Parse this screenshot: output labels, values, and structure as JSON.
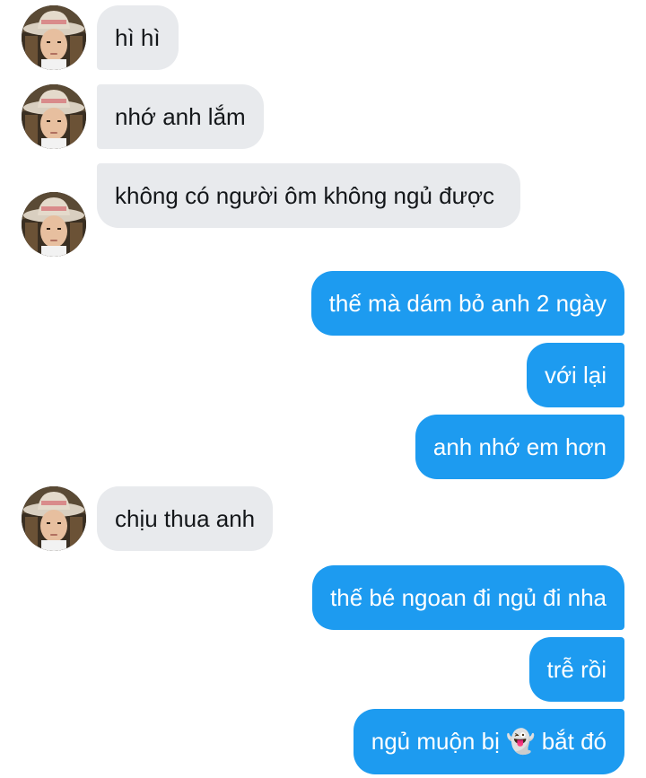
{
  "conversation": {
    "messages": [
      {
        "sender": "other",
        "text": "hì hì"
      },
      {
        "sender": "other",
        "text": "nhớ anh lắm"
      },
      {
        "sender": "other",
        "text": "không có người ôm không ngủ được"
      },
      {
        "sender": "self",
        "text": "thế mà dám bỏ anh 2 ngày"
      },
      {
        "sender": "self",
        "text": "với lại"
      },
      {
        "sender": "self",
        "text": "anh nhớ em hơn"
      },
      {
        "sender": "other",
        "text": "chịu thua anh"
      },
      {
        "sender": "self",
        "text": "thế bé ngoan đi ngủ đi nha"
      },
      {
        "sender": "self",
        "text": "trễ rồi"
      },
      {
        "sender": "self",
        "text_before": "ngủ muộn bị",
        "emoji": "👻",
        "text_after": "bắt đó"
      }
    ]
  },
  "colors": {
    "incoming_bubble": "#e8eaed",
    "outgoing_bubble": "#1d9bf0",
    "incoming_text": "#14171a",
    "outgoing_text": "#ffffff"
  },
  "icons": {
    "avatar": "profile-photo-man-in-cowboy-hat"
  }
}
